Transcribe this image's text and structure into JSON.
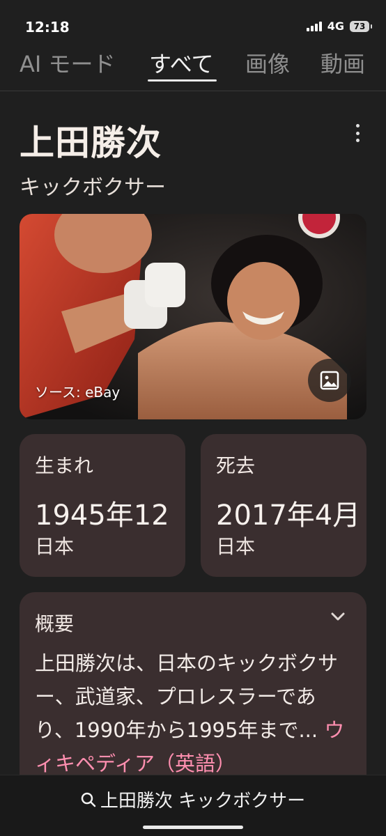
{
  "status": {
    "time": "12:18",
    "network": "4G",
    "battery": "73"
  },
  "tabs": [
    {
      "label": "AI モード"
    },
    {
      "label": "すべて"
    },
    {
      "label": "画像"
    },
    {
      "label": "動画"
    }
  ],
  "entity": {
    "name": "上田勝次",
    "type": "キックボクサー"
  },
  "photo": {
    "source": "ソース: eBay"
  },
  "facts": {
    "born": {
      "label": "生まれ",
      "value": "1945年12",
      "place": "日本"
    },
    "died": {
      "label": "死去",
      "value": "2017年4月",
      "place": "日本"
    }
  },
  "overview": {
    "title": "概要",
    "text": "上田勝次は、日本のキックボクサー、武道家、プロレスラーであり、1990年から1995年まで",
    "ellipsis": "...",
    "link": "ウィキペディア（英語）"
  },
  "bottom": {
    "query": "上田勝次 キックボクサー"
  },
  "colors": {
    "background": "#1f1f1f",
    "card": "#3a2e2f",
    "link": "#ff8fb0"
  }
}
